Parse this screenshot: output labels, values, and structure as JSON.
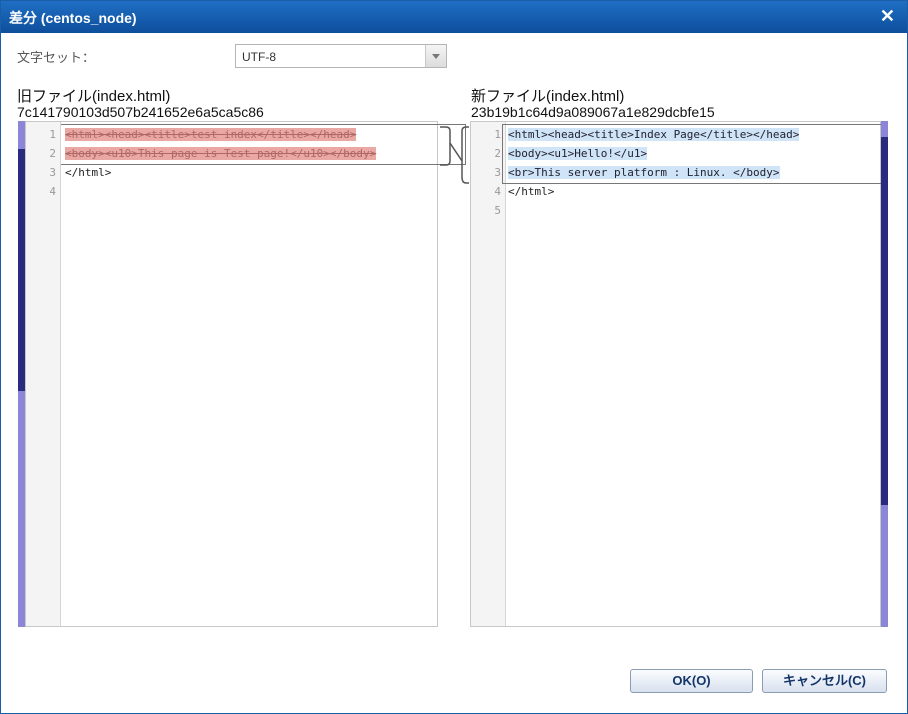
{
  "dialog": {
    "title": "差分 (centos_node)",
    "close_label": "✕"
  },
  "charset": {
    "label": "文字セット：",
    "value": "UTF-8"
  },
  "old_file": {
    "title": "旧ファイル(index.html)",
    "hash": "7c141790103d507b241652e6a5ca5c86",
    "line_numbers": [
      "1",
      "2",
      "3",
      "4"
    ],
    "lines": [
      "<html><head><title>test index</title></head>",
      "<body><u10>This page is Test page!</u10></body>",
      "</html>",
      ""
    ]
  },
  "new_file": {
    "title": "新ファイル(index.html)",
    "hash": "23b19b1c64d9a089067a1e829dcbfe15",
    "line_numbers": [
      "1",
      "2",
      "3",
      "4",
      "5"
    ],
    "lines": [
      "<html><head><title>Index Page</title></head>",
      "<body><u1>Hello!</u1>",
      "<br>This server platform : Linux. </body>",
      "</html>",
      ""
    ]
  },
  "buttons": {
    "ok": "OK(O)",
    "cancel": "キャンセル(C)"
  },
  "colors": {
    "deleted": "#e9a8a4",
    "inserted": "#cfe4f6",
    "overview_dark": "#2a2a7e",
    "overview_light": "#8b86d8"
  }
}
